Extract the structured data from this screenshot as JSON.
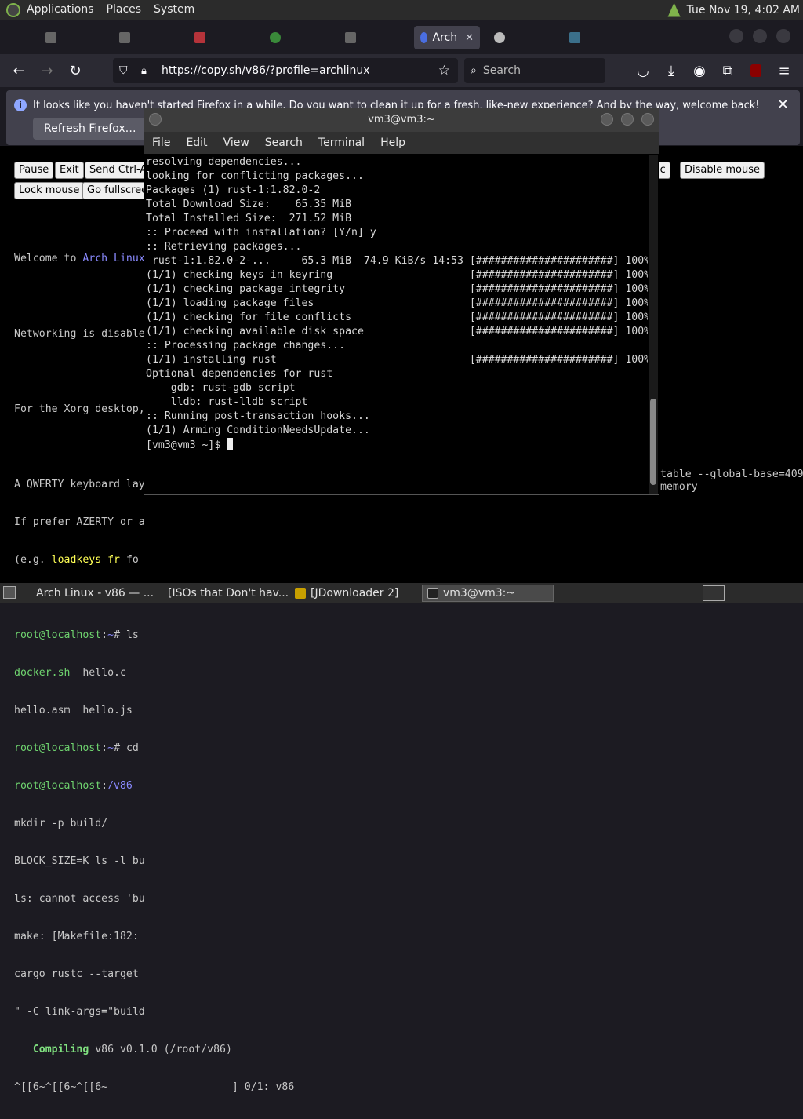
{
  "top_panel": {
    "menus": [
      "Applications",
      "Places",
      "System"
    ],
    "clock": "Tue Nov 19,  4:02 AM"
  },
  "browser": {
    "active_tab": "Arch",
    "url": "https://copy.sh/v86/?profile=archlinux",
    "search_placeholder": "Search",
    "notification": "It looks like you haven't started Firefox in a while. Do you want to clean it up for a fresh, like-new experience? And by the way, welcome back!",
    "refresh_button": "Refresh Firefox…"
  },
  "v86": {
    "buttons": {
      "pause": "Pause",
      "exit": "Exit",
      "send_ctrl_alt": "Send Ctrl-A",
      "lock_mouse": "Lock mouse",
      "fullscreen": "Go fullscree",
      "traffic": "ffic",
      "disable_mouse": "Disable mouse"
    },
    "screen_lines": [
      "",
      "Networking is disable",
      "",
      "For the Xorg desktop,",
      "",
      "A QWERTY keyboard lay",
      "If prefer AZERTY or a",
      "(e.g. ",
      "",
      "",
      "hello.asm  hello.js",
      "",
      "",
      "mkdir -p build/",
      "BLOCK_SIZE=K ls -l bu",
      "ls: cannot access 'bu",
      "make: [Makefile:182:",
      "cargo rustc --target",
      "\" -C link-args=\"build",
      "",
      "^[[6~^[[6~^[[6~                    ] 0/1: v86"
    ],
    "welcome_prefix": "Welcome to ",
    "welcome_arch": "Arch Linux",
    "loadkeys": "loadkeys fr",
    "loadkeys_tail": " fo",
    "prompt_root": "root@localhost",
    "prompt_tilde": "~",
    "prompt_hash": "# ls",
    "prompt_hash_cd": "# cd",
    "prompt_v86": "/v86",
    "ls_docker": "docker.sh",
    "ls_hello_c": "  hello.c",
    "right_overflow_1": "table --global-base=409",
    "right_overflow_2": "memory",
    "compiling_word": "Compiling",
    "compiling_rest": " v86 v0.1.0 (/root/v86)"
  },
  "terminal": {
    "title": "vm3@vm3:~",
    "menu": [
      "File",
      "Edit",
      "View",
      "Search",
      "Terminal",
      "Help"
    ],
    "lines": [
      "resolving dependencies...",
      "looking for conflicting packages...",
      "",
      "Packages (1) rust-1:1.82.0-2",
      "",
      "Total Download Size:    65.35 MiB",
      "Total Installed Size:  271.52 MiB",
      "",
      ":: Proceed with installation? [Y/n] y",
      ":: Retrieving packages...",
      " rust-1:1.82.0-2-...     65.3 MiB  74.9 KiB/s 14:53 [######################] 100%",
      "(1/1) checking keys in keyring                      [######################] 100%",
      "(1/1) checking package integrity                    [######################] 100%",
      "(1/1) loading package files                         [######################] 100%",
      "(1/1) checking for file conflicts                   [######################] 100%",
      "(1/1) checking available disk space                 [######################] 100%",
      ":: Processing package changes...",
      "(1/1) installing rust                               [######################] 100%",
      "Optional dependencies for rust",
      "    gdb: rust-gdb script",
      "    lldb: rust-lldb script",
      ":: Running post-transaction hooks...",
      "(1/1) Arming ConditionNeedsUpdate..."
    ],
    "prompt": "[vm3@vm3 ~]$ "
  },
  "taskbar": {
    "tasks": [
      "Arch Linux - v86 — ...",
      "[ISOs that Don't hav...",
      "[JDownloader 2]",
      "vm3@vm3:~"
    ]
  }
}
